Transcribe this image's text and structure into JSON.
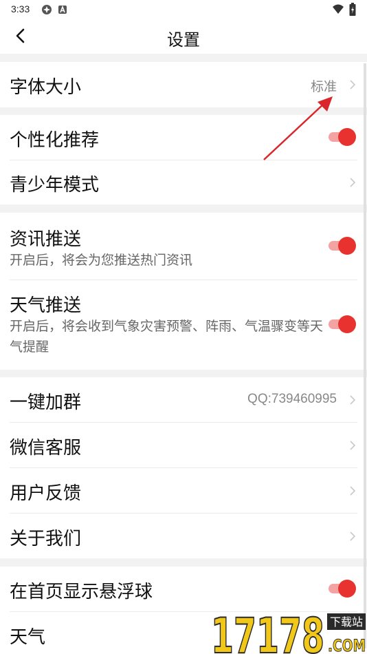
{
  "status_bar": {
    "time": "3:33"
  },
  "header": {
    "title": "设置"
  },
  "sections": {
    "font": {
      "label": "字体大小",
      "value": "标准"
    },
    "personal": {
      "label": "个性化推荐",
      "enabled": true
    },
    "teen": {
      "label": "青少年模式"
    },
    "news": {
      "label": "资讯推送",
      "desc": "开启后，将会为您推送热门资讯",
      "enabled": true
    },
    "weather_push": {
      "label": "天气推送",
      "desc": "开启后，将会收到气象灾害预警、阵雨、气温骤变等天气提醒",
      "enabled": true
    },
    "group": {
      "label": "一键加群",
      "value": "QQ:739460995"
    },
    "wechat": {
      "label": "微信客服"
    },
    "feedback": {
      "label": "用户反馈"
    },
    "about": {
      "label": "关于我们"
    },
    "float_ball": {
      "label": "在首页显示悬浮球",
      "enabled": true
    },
    "weather": {
      "label": "天气"
    }
  },
  "watermark": {
    "number": "17178",
    "tag": "下载站",
    "domain": ".COM"
  },
  "colors": {
    "accent": "#e8322f",
    "track": "#f4a3a3",
    "background": "#f2f2f2"
  }
}
